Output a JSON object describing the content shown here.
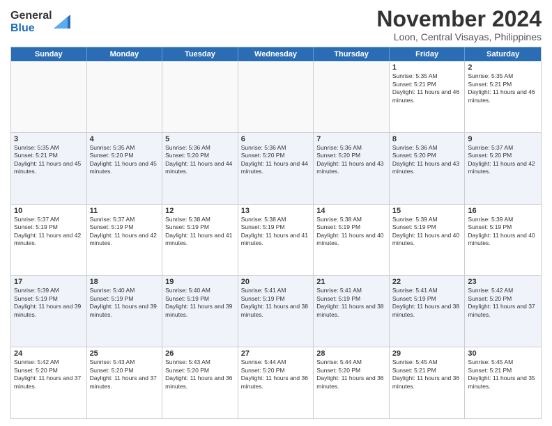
{
  "logo": {
    "general": "General",
    "blue": "Blue"
  },
  "title": "November 2024",
  "location": "Loon, Central Visayas, Philippines",
  "header_days": [
    "Sunday",
    "Monday",
    "Tuesday",
    "Wednesday",
    "Thursday",
    "Friday",
    "Saturday"
  ],
  "weeks": [
    [
      {
        "day": "",
        "text": "",
        "empty": true
      },
      {
        "day": "",
        "text": "",
        "empty": true
      },
      {
        "day": "",
        "text": "",
        "empty": true
      },
      {
        "day": "",
        "text": "",
        "empty": true
      },
      {
        "day": "",
        "text": "",
        "empty": true
      },
      {
        "day": "1",
        "text": "Sunrise: 5:35 AM\nSunset: 5:21 PM\nDaylight: 11 hours and 46 minutes."
      },
      {
        "day": "2",
        "text": "Sunrise: 5:35 AM\nSunset: 5:21 PM\nDaylight: 11 hours and 46 minutes."
      }
    ],
    [
      {
        "day": "3",
        "text": "Sunrise: 5:35 AM\nSunset: 5:21 PM\nDaylight: 11 hours and 45 minutes."
      },
      {
        "day": "4",
        "text": "Sunrise: 5:35 AM\nSunset: 5:20 PM\nDaylight: 11 hours and 45 minutes."
      },
      {
        "day": "5",
        "text": "Sunrise: 5:36 AM\nSunset: 5:20 PM\nDaylight: 11 hours and 44 minutes."
      },
      {
        "day": "6",
        "text": "Sunrise: 5:36 AM\nSunset: 5:20 PM\nDaylight: 11 hours and 44 minutes."
      },
      {
        "day": "7",
        "text": "Sunrise: 5:36 AM\nSunset: 5:20 PM\nDaylight: 11 hours and 43 minutes."
      },
      {
        "day": "8",
        "text": "Sunrise: 5:36 AM\nSunset: 5:20 PM\nDaylight: 11 hours and 43 minutes."
      },
      {
        "day": "9",
        "text": "Sunrise: 5:37 AM\nSunset: 5:20 PM\nDaylight: 11 hours and 42 minutes."
      }
    ],
    [
      {
        "day": "10",
        "text": "Sunrise: 5:37 AM\nSunset: 5:19 PM\nDaylight: 11 hours and 42 minutes."
      },
      {
        "day": "11",
        "text": "Sunrise: 5:37 AM\nSunset: 5:19 PM\nDaylight: 11 hours and 42 minutes."
      },
      {
        "day": "12",
        "text": "Sunrise: 5:38 AM\nSunset: 5:19 PM\nDaylight: 11 hours and 41 minutes."
      },
      {
        "day": "13",
        "text": "Sunrise: 5:38 AM\nSunset: 5:19 PM\nDaylight: 11 hours and 41 minutes."
      },
      {
        "day": "14",
        "text": "Sunrise: 5:38 AM\nSunset: 5:19 PM\nDaylight: 11 hours and 40 minutes."
      },
      {
        "day": "15",
        "text": "Sunrise: 5:39 AM\nSunset: 5:19 PM\nDaylight: 11 hours and 40 minutes."
      },
      {
        "day": "16",
        "text": "Sunrise: 5:39 AM\nSunset: 5:19 PM\nDaylight: 11 hours and 40 minutes."
      }
    ],
    [
      {
        "day": "17",
        "text": "Sunrise: 5:39 AM\nSunset: 5:19 PM\nDaylight: 11 hours and 39 minutes."
      },
      {
        "day": "18",
        "text": "Sunrise: 5:40 AM\nSunset: 5:19 PM\nDaylight: 11 hours and 39 minutes."
      },
      {
        "day": "19",
        "text": "Sunrise: 5:40 AM\nSunset: 5:19 PM\nDaylight: 11 hours and 39 minutes."
      },
      {
        "day": "20",
        "text": "Sunrise: 5:41 AM\nSunset: 5:19 PM\nDaylight: 11 hours and 38 minutes."
      },
      {
        "day": "21",
        "text": "Sunrise: 5:41 AM\nSunset: 5:19 PM\nDaylight: 11 hours and 38 minutes."
      },
      {
        "day": "22",
        "text": "Sunrise: 5:41 AM\nSunset: 5:19 PM\nDaylight: 11 hours and 38 minutes."
      },
      {
        "day": "23",
        "text": "Sunrise: 5:42 AM\nSunset: 5:20 PM\nDaylight: 11 hours and 37 minutes."
      }
    ],
    [
      {
        "day": "24",
        "text": "Sunrise: 5:42 AM\nSunset: 5:20 PM\nDaylight: 11 hours and 37 minutes."
      },
      {
        "day": "25",
        "text": "Sunrise: 5:43 AM\nSunset: 5:20 PM\nDaylight: 11 hours and 37 minutes."
      },
      {
        "day": "26",
        "text": "Sunrise: 5:43 AM\nSunset: 5:20 PM\nDaylight: 11 hours and 36 minutes."
      },
      {
        "day": "27",
        "text": "Sunrise: 5:44 AM\nSunset: 5:20 PM\nDaylight: 11 hours and 36 minutes."
      },
      {
        "day": "28",
        "text": "Sunrise: 5:44 AM\nSunset: 5:20 PM\nDaylight: 11 hours and 36 minutes."
      },
      {
        "day": "29",
        "text": "Sunrise: 5:45 AM\nSunset: 5:21 PM\nDaylight: 11 hours and 36 minutes."
      },
      {
        "day": "30",
        "text": "Sunrise: 5:45 AM\nSunset: 5:21 PM\nDaylight: 11 hours and 35 minutes."
      }
    ]
  ]
}
